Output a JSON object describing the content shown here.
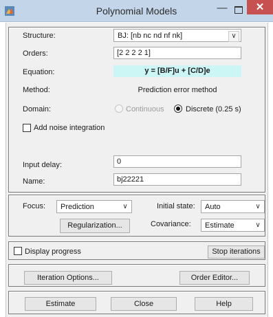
{
  "window": {
    "title": "Polynomial Models",
    "minimize_glyph": "—",
    "close_glyph": "✕",
    "icon": "matlab-icon"
  },
  "structure": {
    "label": "Structure:",
    "value": "BJ: [nb nc nd nf nk]",
    "arrow": "∨"
  },
  "orders": {
    "label": "Orders:",
    "value": "[2 2 2 2 1]"
  },
  "equation": {
    "label": "Equation:",
    "value": "y = [B/F]u + [C/D]e"
  },
  "method": {
    "label": "Method:",
    "value": "Prediction error method"
  },
  "domain": {
    "label": "Domain:",
    "continuous_label": "Continuous",
    "continuous_selected": false,
    "continuous_enabled": false,
    "discrete_label": "Discrete (0.25 s)",
    "discrete_selected": true
  },
  "noise_integration": {
    "label": "Add noise integration",
    "checked": false
  },
  "input_delay": {
    "label": "Input delay:",
    "value": "0"
  },
  "name": {
    "label": "Name:",
    "value": "bj22221"
  },
  "focus": {
    "label": "Focus:",
    "value": "Prediction",
    "arrow": "∨"
  },
  "regularization_button": "Regularization...",
  "initial_state": {
    "label": "Initial state:",
    "value": "Auto",
    "arrow": "∨"
  },
  "covariance": {
    "label": "Covariance:",
    "value": "Estimate",
    "arrow": "∨"
  },
  "display_progress": {
    "label": "Display progress",
    "checked": false
  },
  "stop_iterations_button": "Stop iterations",
  "iteration_options_button": "Iteration Options...",
  "order_editor_button": "Order Editor...",
  "estimate_button": "Estimate",
  "close_button": "Close",
  "help_button": "Help",
  "colors": {
    "titlebar": "#c2d5e9",
    "close_button": "#c75050",
    "equation_highlight": "#ccf5f5",
    "dialog_background": "#f0f0f0"
  }
}
